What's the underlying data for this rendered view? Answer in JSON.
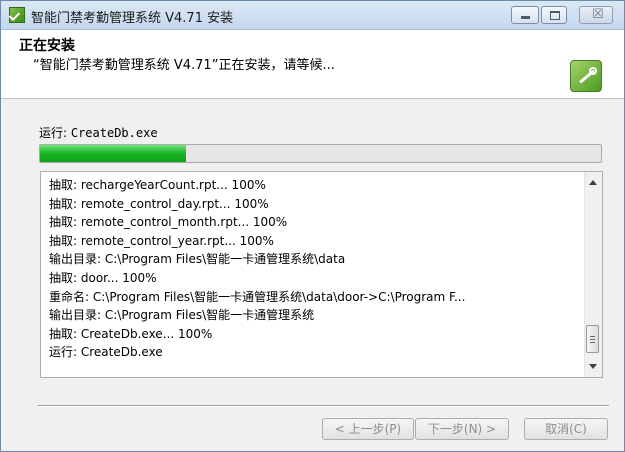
{
  "window": {
    "title": "智能门禁考勤管理系统 V4.71 安装",
    "close_glyph": "☒"
  },
  "header": {
    "title": "正在安装",
    "subtitle": "“智能门禁考勤管理系统 V4.71”正在安装，请等候..."
  },
  "status": {
    "label": "运行: ",
    "value": "CreateDb.exe"
  },
  "progress": {
    "fraction": 0.26
  },
  "log": {
    "lines": [
      "抽取: rechargeYearCount.rpt... 100%",
      "抽取: remote_control_day.rpt... 100%",
      "抽取: remote_control_month.rpt... 100%",
      "抽取: remote_control_year.rpt... 100%",
      "输出目录: C:\\Program Files\\智能一卡通管理系统\\data",
      "抽取: door... 100%",
      "重命名: C:\\Program Files\\智能一卡通管理系统\\data\\door->C:\\Program F...",
      "输出目录: C:\\Program Files\\智能一卡通管理系统",
      "抽取: CreateDb.exe... 100%",
      "运行: CreateDb.exe"
    ]
  },
  "buttons": {
    "back": "< 上一步(P)",
    "next": "下一步(N) >",
    "cancel": "取消(C)"
  },
  "colors": {
    "progress": "#16b323",
    "disabled_text": "#8d8d8d"
  }
}
